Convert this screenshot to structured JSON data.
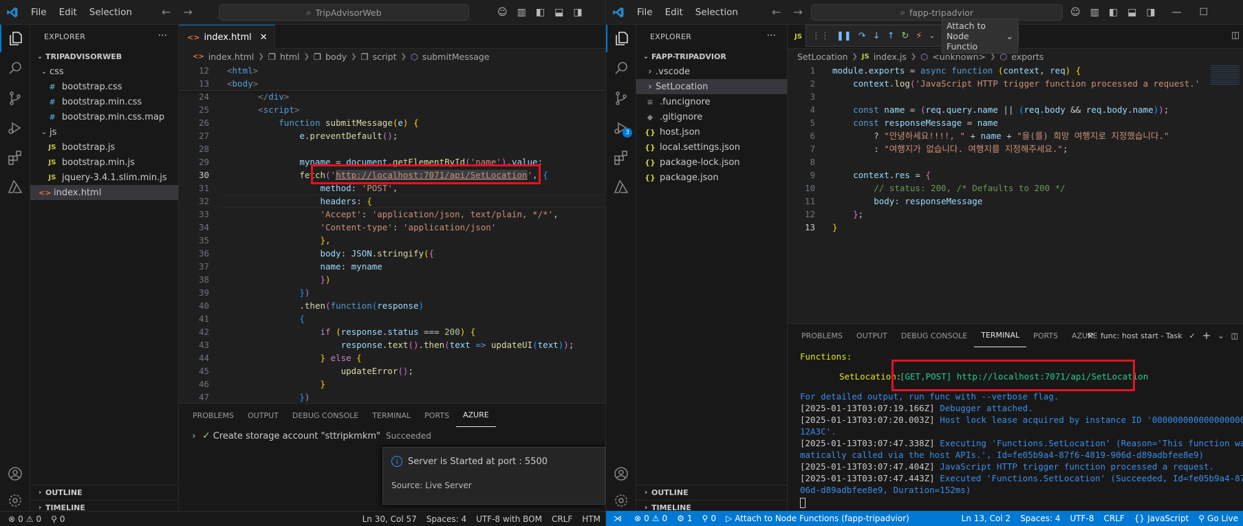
{
  "menu": {
    "file": "File",
    "edit": "Edit",
    "selection": "Selection"
  },
  "left": {
    "search": "TripAdvisorWeb",
    "explorer_title": "EXPLORER",
    "root": "TRIPADVISORWEB",
    "folders": {
      "css": "css",
      "js": "js"
    },
    "files": {
      "bootstrap_css": "bootstrap.css",
      "bootstrap_min_css": "bootstrap.min.css",
      "bootstrap_min_css_map": "bootstrap.min.css.map",
      "bootstrap_js": "bootstrap.js",
      "bootstrap_min_js": "bootstrap.min.js",
      "jquery": "jquery-3.4.1.slim.min.js",
      "index_html": "index.html"
    },
    "outline": "OUTLINE",
    "timeline": "TIMELINE",
    "tab": "index.html",
    "breadcrumb": [
      "index.html",
      "html",
      "body",
      "script",
      "submitMessage"
    ],
    "line_numbers": [
      "12",
      "13",
      "24",
      "25",
      "26",
      "27",
      "28",
      "29",
      "30",
      "31",
      "32",
      "33",
      "34",
      "35",
      "36",
      "37",
      "38",
      "39",
      "40",
      "41",
      "42",
      "43",
      "44",
      "45",
      "46",
      "47"
    ],
    "panel_tabs": [
      "PROBLEMS",
      "OUTPUT",
      "DEBUG CONSOLE",
      "TERMINAL",
      "PORTS",
      "AZURE"
    ],
    "azure_item": "Create storage account \"sttripkmkm\"",
    "azure_status": "Succeeded",
    "toast_message": "Server is Started at port : 5500",
    "toast_source": "Source: Live Server",
    "status": {
      "errors": "0",
      "warnings": "0",
      "ports": "0",
      "position": "Ln 30, Col 57",
      "spaces": "Spaces: 4",
      "encoding": "UTF-8 with BOM",
      "eol": "CRLF",
      "lang": "HTM"
    }
  },
  "right": {
    "search": "fapp-tripadvior",
    "debug_target": "Attach to Node Functio",
    "explorer_title": "EXPLORER",
    "root": "FAPP-TRIPADVIOR",
    "items": {
      "vscode": ".vscode",
      "setlocation": "SetLocation",
      "funcignore": ".funcignore",
      "gitignore": ".gitignore",
      "host": "host.json",
      "local": "local.settings.json",
      "lock": "package-lock.json",
      "package": "package.json"
    },
    "outline": "OUTLINE",
    "timeline": "TIMELINE",
    "breadcrumb": [
      "SetLocation",
      "index.js",
      "<unknown>",
      "exports"
    ],
    "line_numbers": [
      "1",
      "2",
      "3",
      "4",
      "5",
      "6",
      "7",
      "8",
      "9",
      "10",
      "11",
      "12",
      "13"
    ],
    "panel_tabs": [
      "PROBLEMS",
      "OUTPUT",
      "DEBUG CONSOLE",
      "TERMINAL",
      "PORTS",
      "AZURE"
    ],
    "task": "func: host start - Task",
    "terminal": {
      "functions": "Functions:",
      "setloc_name": "SetLocation:",
      "setloc_url": "[GET,POST] http://localhost:7071/api/SetLocation",
      "l1": "For detailed output, run func with --verbose flag.",
      "l2a": "[2025-01-13T03:07:19.166Z]",
      "l2b": "Debugger attached.",
      "l3a": "[2025-01-13T03:07:20.003Z]",
      "l3b": "Host lock lease acquired by instance ID '00000000000000000000000000",
      "l3c": "12A3C'.",
      "l4a": "[2025-01-13T03:07:47.338Z]",
      "l4b": "Executing 'Functions.SetLocation' (Reason='This function was prog",
      "l4c": "matically called via the host APIs.', Id=fe05b9a4-87f6-4819-906d-d89adbfee8e9)",
      "l5a": "[2025-01-13T03:07:47.404Z]",
      "l5b": "JavaScript HTTP trigger function processed a request.",
      "l6a": "[2025-01-13T03:07:47.443Z]",
      "l6b": "Executed 'Functions.SetLocation' (Succeeded, Id=fe05b9a4-87f6-481",
      "l6c": "06d-d89adbfee8e9, Duration=152ms)"
    },
    "status": {
      "errors": "0",
      "warnings": "0",
      "debug": "1",
      "ports": "0",
      "attach": "Attach to Node Functions (fapp-tripadvior)",
      "position": "Ln 13, Col 2",
      "spaces": "Spaces: 4",
      "encoding": "UTF-8",
      "eol": "CRLF",
      "lang": "JavaScript",
      "golive": "Go Live"
    }
  }
}
